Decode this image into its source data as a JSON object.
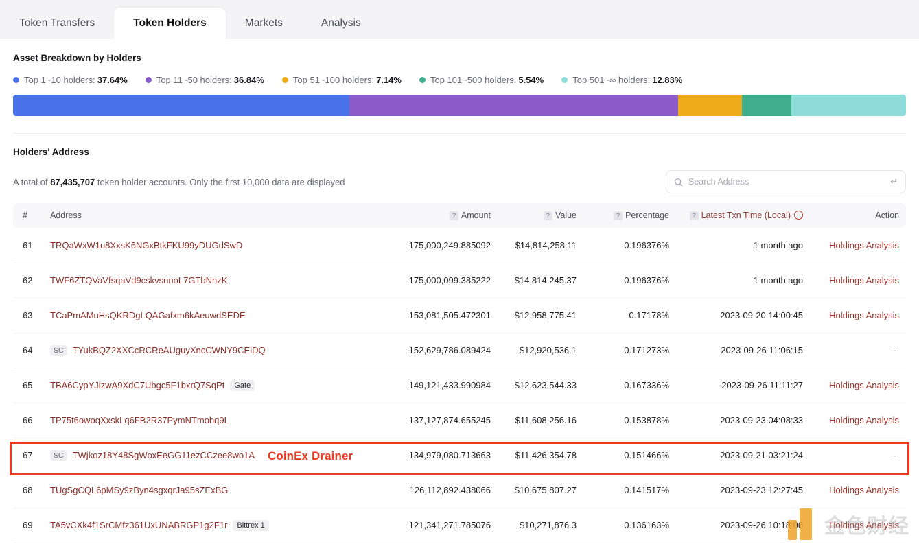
{
  "tabs": [
    {
      "label": "Token Transfers",
      "active": false
    },
    {
      "label": "Token Holders",
      "active": true
    },
    {
      "label": "Markets",
      "active": false
    },
    {
      "label": "Analysis",
      "active": false
    }
  ],
  "breakdown": {
    "title": "Asset Breakdown by Holders",
    "legend": [
      {
        "label": "Top 1~10 holders:",
        "value": "37.64%",
        "pct": 37.64,
        "color": "#4a72e8"
      },
      {
        "label": "Top 11~50 holders:",
        "value": "36.84%",
        "pct": 36.84,
        "color": "#8b5bc9"
      },
      {
        "label": "Top 51~100 holders:",
        "value": "7.14%",
        "pct": 7.14,
        "color": "#efac1a"
      },
      {
        "label": "Top 101~500 holders:",
        "value": "5.54%",
        "pct": 5.54,
        "color": "#3fae8c"
      },
      {
        "label": "Top 501~∞ holders:",
        "value": "12.83%",
        "pct": 12.83,
        "color": "#8fdddb"
      }
    ]
  },
  "holders": {
    "title": "Holders' Address",
    "total_prefix": "A total of ",
    "total_count": "87,435,707",
    "total_suffix": " token holder accounts. Only the first 10,000 data are displayed",
    "search_placeholder": "Search Address",
    "search_value": "",
    "enter_glyph": "↵",
    "columns": {
      "num": "#",
      "address": "Address",
      "amount": "Amount",
      "value": "Value",
      "percentage": "Percentage",
      "time": "Latest Txn Time (Local)",
      "action": "Action"
    },
    "rows": [
      {
        "num": "61",
        "sc": "",
        "address": "TRQaWxW1u8XxsK6NGxBtkFKU99yDUGdSwD",
        "tag": "",
        "amount": "175,000,249.885092",
        "value": "$14,814,258.11",
        "percentage": "0.196376%",
        "time": "1 month ago",
        "action": "Holdings Analysis",
        "highlight": false
      },
      {
        "num": "62",
        "sc": "",
        "address": "TWF6ZTQVaVfsqaVd9cskvsnnoL7GTbNnzK",
        "tag": "",
        "amount": "175,000,099.385222",
        "value": "$14,814,245.37",
        "percentage": "0.196376%",
        "time": "1 month ago",
        "action": "Holdings Analysis",
        "highlight": false
      },
      {
        "num": "63",
        "sc": "",
        "address": "TCaPmAMuHsQKRDgLQAGafxm6kAeuwdSEDE",
        "tag": "",
        "amount": "153,081,505.472301",
        "value": "$12,958,775.41",
        "percentage": "0.17178%",
        "time": "2023-09-20 14:00:45",
        "action": "Holdings Analysis",
        "highlight": false
      },
      {
        "num": "64",
        "sc": "SC",
        "address": "TYukBQZ2XXCcRCReAUguyXncCWNY9CEiDQ",
        "tag": "",
        "amount": "152,629,786.089424",
        "value": "$12,920,536.1",
        "percentage": "0.171273%",
        "time": "2023-09-26 11:06:15",
        "action": "--",
        "highlight": false
      },
      {
        "num": "65",
        "sc": "",
        "address": "TBA6CypYJizwA9XdC7Ubgc5F1bxrQ7SqPt",
        "tag": "Gate",
        "amount": "149,121,433.990984",
        "value": "$12,623,544.33",
        "percentage": "0.167336%",
        "time": "2023-09-26 11:11:27",
        "action": "Holdings Analysis",
        "highlight": false
      },
      {
        "num": "66",
        "sc": "",
        "address": "TP75t6owoqXxskLq6FB2R37PymNTmohq9L",
        "tag": "",
        "amount": "137,127,874.655245",
        "value": "$11,608,256.16",
        "percentage": "0.153878%",
        "time": "2023-09-23 04:08:33",
        "action": "Holdings Analysis",
        "highlight": true
      },
      {
        "num": "67",
        "sc": "SC",
        "address": "TWjkoz18Y48SgWoxEeGG11ezCCzee8wo1A",
        "tag": "",
        "amount": "134,979,080.713663",
        "value": "$11,426,354.78",
        "percentage": "0.151466%",
        "time": "2023-09-21 03:21:24",
        "action": "--",
        "highlight": false
      },
      {
        "num": "68",
        "sc": "",
        "address": "TUgSgCQL6pMSy9zByn4sgxqrJa95sZExBG",
        "tag": "",
        "amount": "126,112,892.438066",
        "value": "$10,675,807.27",
        "percentage": "0.141517%",
        "time": "2023-09-23 12:27:45",
        "action": "Holdings Analysis",
        "highlight": false
      },
      {
        "num": "69",
        "sc": "",
        "address": "TA5vCXk4f1SrCMfz361UxUNABRGP1g2F1r",
        "tag": "Bittrex 1",
        "amount": "121,341,271.785076",
        "value": "$10,271,876.3",
        "percentage": "0.136163%",
        "time": "2023-09-26 10:18:06",
        "action": "Holdings Analysis",
        "highlight": false
      }
    ]
  },
  "annotation": {
    "text": "CoinEx Drainer",
    "color": "#ef3b21"
  },
  "watermark": {
    "text": "金色财经"
  }
}
